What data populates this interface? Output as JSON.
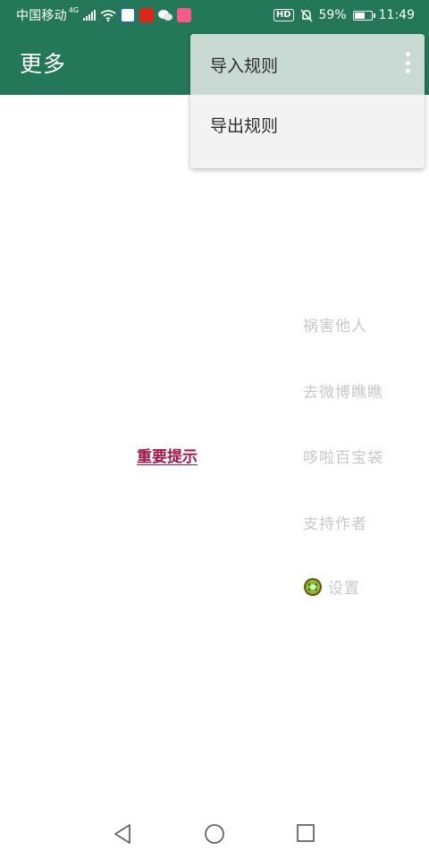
{
  "status_bar": {
    "carrier": "中国移动",
    "network": "4G",
    "battery": "59%",
    "battery_level": 0.59,
    "time": "11:49",
    "hd_badge": "HD"
  },
  "app_bar": {
    "title": "更多"
  },
  "overflow_menu": {
    "items": [
      {
        "label": "导入规则"
      },
      {
        "label": "导出规则"
      }
    ]
  },
  "main": {
    "important_notice": "重要提示",
    "links": [
      {
        "label": "祸害他人"
      },
      {
        "label": "去微博瞧瞧"
      },
      {
        "label": "哆啦百宝袋"
      },
      {
        "label": "支持作者"
      },
      {
        "label": "设置",
        "icon": "kiwi-icon"
      }
    ]
  },
  "colors": {
    "primary": "#24785a",
    "menu_highlight": "#c8dad3",
    "accent_link": "#a0174a",
    "muted_text": "#c8c8c8"
  }
}
